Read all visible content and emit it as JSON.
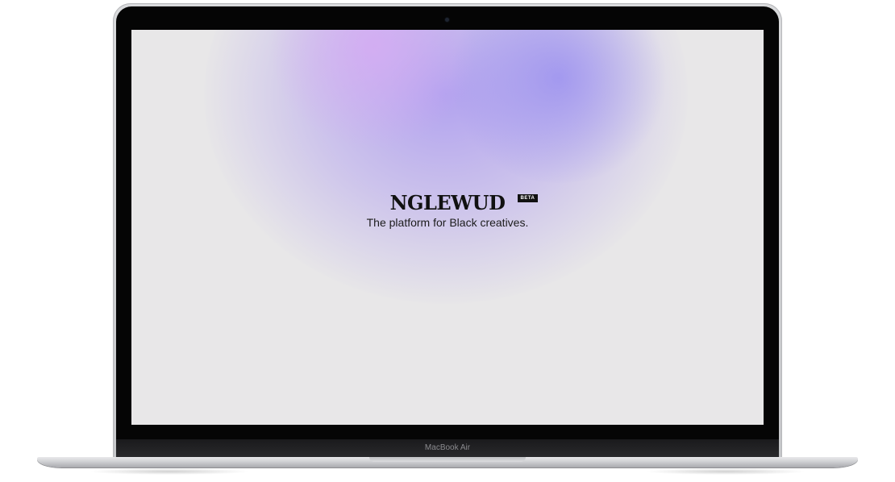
{
  "device": {
    "label": "MacBook Air"
  },
  "page": {
    "logo": "NGLEWUD",
    "badge": "BETA",
    "tagline": "The platform for Black creatives."
  }
}
